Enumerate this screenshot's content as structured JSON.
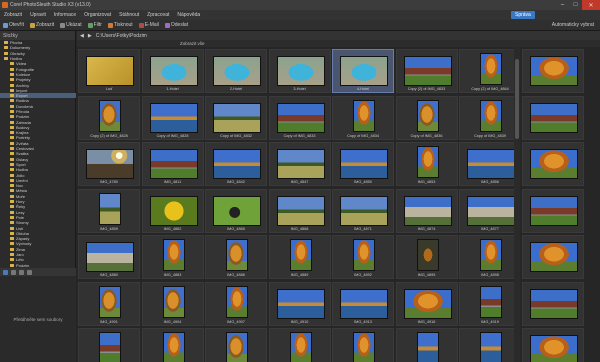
{
  "window": {
    "title": "Corel PhotoSleuth Studio X3 (v13.0)"
  },
  "menu": [
    "Zobrazit",
    "Upravit",
    "Informace",
    "Organizovat",
    "Stáhnout",
    "Zpracovat",
    "Nápověda"
  ],
  "modes": {
    "active": "Správa"
  },
  "toolbar": {
    "items": [
      "Otevřít",
      "Zobrazit",
      "Ukázat",
      "Filtr",
      "Tisknout",
      "E-Mail",
      "Odeslat"
    ],
    "right_label": "Automaticky vybrat"
  },
  "left_panel": {
    "tab_folders": "Složky",
    "tree": [
      "Plocha",
      "Dokumenty",
      "Obrázky",
      "Hudba",
      "Videa",
      "Fotografie",
      "Kolekce",
      "Projekty",
      "Archivy",
      "Import",
      "Export",
      "Rodina",
      "Dovolená",
      "Příroda",
      "Podzim",
      "Zahrada",
      "Budovy",
      "Krajina",
      "Portréty",
      "Zvířata",
      "Cestování",
      "Svatba",
      "Oslavy",
      "Sport",
      "Hudba",
      "Jídlo",
      "Umění",
      "Noc",
      "Města",
      "Moře",
      "Hory",
      "Řeky",
      "Lesy",
      "Pole",
      "Stromy",
      "Listí",
      "Obloha",
      "Západy",
      "Východy",
      "Zima",
      "Jaro",
      "Léto",
      "Podzim"
    ],
    "drop_hint": "Přetáhněte sem soubory"
  },
  "pathbar": {
    "path": "C:\\Users\\Fotky\\Podzim",
    "filter_label": "Zobrazit vše"
  },
  "thumbnails": [
    {
      "caption": "Loď",
      "style": "t-yellow"
    },
    {
      "caption": "1-Hotel",
      "style": "t-pool"
    },
    {
      "caption": "2-Hotel",
      "style": "t-pool"
    },
    {
      "caption": "3-Hotel",
      "style": "t-pool"
    },
    {
      "caption": "4-Hotel",
      "style": "t-pool"
    },
    {
      "caption": "Copy (2) of IMG_4833",
      "style": "t-house"
    },
    {
      "caption": "Copy (2) of IMG_4864",
      "style": "t-tree"
    },
    {
      "caption": "Copy (2) of IMG_4828",
      "style": "t-tree2"
    },
    {
      "caption": "Copy of IMG_4828",
      "style": "t-lake"
    },
    {
      "caption": "Copy of IMG_4832",
      "style": "t-field"
    },
    {
      "caption": "Copy of IMG_4833",
      "style": "t-house"
    },
    {
      "caption": "Copy of IMG_4834",
      "style": "t-tree"
    },
    {
      "caption": "Copy of IMG_4836",
      "style": "t-tree2"
    },
    {
      "caption": "Copy of IMG_4839",
      "style": "t-tree"
    },
    {
      "caption": "IMG_4780",
      "style": "t-sun"
    },
    {
      "caption": "IMG_4811",
      "style": "t-house"
    },
    {
      "caption": "IMG_4842",
      "style": "t-lake"
    },
    {
      "caption": "IMG_4847",
      "style": "t-field"
    },
    {
      "caption": "IMG_4850",
      "style": "t-lake"
    },
    {
      "caption": "IMG_4853",
      "style": "t-tree"
    },
    {
      "caption": "IMG_4856",
      "style": "t-lake"
    },
    {
      "caption": "IMG_4859",
      "style": "t-field"
    },
    {
      "caption": "IMG_4862",
      "style": "t-flower"
    },
    {
      "caption": "IMG_4865",
      "style": "t-dog"
    },
    {
      "caption": "IMG_4868",
      "style": "t-field"
    },
    {
      "caption": "IMG_4871",
      "style": "t-field"
    },
    {
      "caption": "IMG_4874",
      "style": "t-build"
    },
    {
      "caption": "IMG_4877",
      "style": "t-build"
    },
    {
      "caption": "IMG_4880",
      "style": "t-build"
    },
    {
      "caption": "IMG_4883",
      "style": "t-tree"
    },
    {
      "caption": "IMG_4886",
      "style": "t-tree2"
    },
    {
      "caption": "IMG_4889",
      "style": "t-tree"
    },
    {
      "caption": "IMG_4892",
      "style": "t-tree"
    },
    {
      "caption": "IMG_4895",
      "style": "t-dark"
    },
    {
      "caption": "IMG_4898",
      "style": "t-tree"
    },
    {
      "caption": "IMG_4901",
      "style": "t-tree2"
    },
    {
      "caption": "IMG_4904",
      "style": "t-tree2"
    },
    {
      "caption": "IMG_4907",
      "style": "t-tree"
    },
    {
      "caption": "IMG_4910",
      "style": "t-lake"
    },
    {
      "caption": "IMG_4913",
      "style": "t-lake"
    },
    {
      "caption": "IMG_4916",
      "style": "t-tree"
    },
    {
      "caption": "IMG_4919",
      "style": "t-house"
    },
    {
      "caption": "IMG_4922",
      "style": "t-house"
    },
    {
      "caption": "IMG_4925",
      "style": "t-tree"
    },
    {
      "caption": "IMG_4928",
      "style": "t-tree2"
    },
    {
      "caption": "IMG_4931",
      "style": "t-tree"
    },
    {
      "caption": "IMG_4934",
      "style": "t-tree"
    },
    {
      "caption": "IMG_4937",
      "style": "t-lake"
    },
    {
      "caption": "IMG_4940",
      "style": "t-lake"
    },
    {
      "caption": "IMG_4943",
      "style": "t-tree"
    },
    {
      "caption": "IMG_4946",
      "style": "t-tree2"
    },
    {
      "caption": "IMG_4949",
      "style": "t-house"
    },
    {
      "caption": "IMG_4952",
      "style": "t-tree"
    },
    {
      "caption": "IMG_4955",
      "style": "t-sun"
    },
    {
      "caption": "IMG_4958",
      "style": "t-tree2"
    },
    {
      "caption": "Blowup 12",
      "style": "t-tree"
    },
    {
      "caption": "Okraj",
      "style": "t-sun"
    }
  ]
}
